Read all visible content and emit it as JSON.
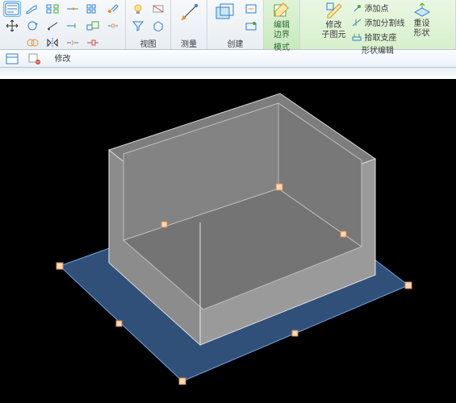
{
  "ribbon": {
    "panels": {
      "modify": {
        "title": "修改"
      },
      "view": {
        "title": "视图"
      },
      "measure": {
        "title": "测量"
      },
      "create": {
        "title": "创建"
      },
      "mode": {
        "title": "模式"
      },
      "edit_boundary": {
        "label_l1": "编辑",
        "label_l2": "边界"
      },
      "modify_sub": {
        "label_l1": "修改",
        "label_l2": "子图元"
      },
      "shape_edit": {
        "title": "形状编辑",
        "add_point": "添加点",
        "add_split": "添加分割线",
        "pick_supp": "拾取支座",
        "reset_l1": "重设",
        "reset_l2": "形状"
      }
    }
  },
  "colors": {
    "blue": "#2e7fd1",
    "orange": "#e7912a",
    "green": "#4da53a",
    "red": "#d14b3d",
    "floor": "#30507a",
    "box": "#8c8c8c",
    "edge": "#d8d8d8",
    "handle": "#ffd7b5",
    "footprint": "#5e8ed4"
  }
}
